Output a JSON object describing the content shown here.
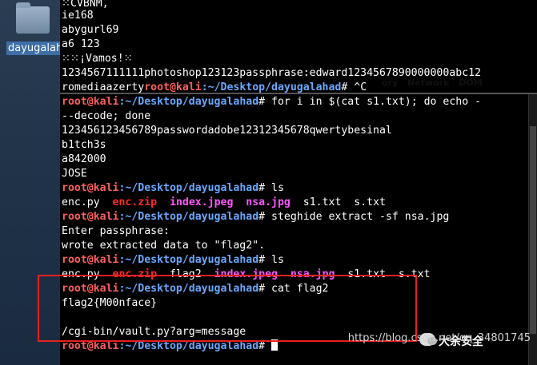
{
  "desktop": {
    "folder_label": "dayugalahad"
  },
  "terminal": {
    "pre_lines": [
      "⁙CVBNM,",
      "ie168",
      "abygurl69",
      "a6 123",
      "⁙⁙¡Vamos!⁙"
    ],
    "long_line": "1234567111111photoshop123123passphrase:edward1234567890000000abc12",
    "romedia_text": "romediaazerty",
    "prompt_user": "root@kali",
    "prompt_path": ":~/Desktop/dayugalahad",
    "prompt_symbol": "#",
    "cmd_ctrl_c": " ^C",
    "cmd_for": " for i in $(cat s1.txt); do echo -",
    "cmd_for_cont": "--decode; done",
    "out_long": "123456123456789passwordadobe12312345678qwertybesinal",
    "out_b1tch": "b1tch3s",
    "out_a842": "a842000",
    "out_jose": "JOSE",
    "cmd_ls": " ls",
    "ls1": {
      "plain1": "enc.py  ",
      "red1": "enc.zip",
      "sp1": "  ",
      "mag1": "index.jpeg",
      "sp2": "  ",
      "mag2": "nsa.jpg",
      "plain2": "  s1.txt  s.txt"
    },
    "cmd_steg": " steghide extract -sf nsa.jpg",
    "out_pass": "Enter passphrase:",
    "out_wrote": "wrote extracted data to \"flag2\".",
    "ls2": {
      "plain1": "enc.py  ",
      "red1": "enc.zip",
      "sp1": "  flag2  ",
      "mag1": "index.jpeg",
      "sp2": "  ",
      "mag2": "nsa.jpg",
      "plain2": "  s1.txt  s.txt"
    },
    "cmd_cat": " cat flag2",
    "out_flag": "flag2{M00nface}",
    "out_blank": "",
    "out_cgi": "/cgi-bin/vault.py?arg=message"
  },
  "ghost_menu": [
    "ory",
    "Network",
    "DOM"
  ],
  "watermark": {
    "title": "大余安全",
    "url": "https://blog.csdn.net/qq_34801745"
  },
  "colors": {
    "prompt_user": "#ff5f5f",
    "prompt_path": "#6aa8ff",
    "highlight_border": "#e52020"
  }
}
